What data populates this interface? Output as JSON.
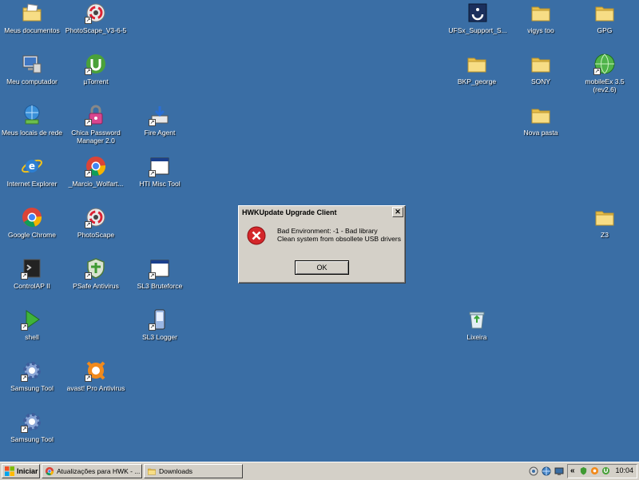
{
  "desktop": {
    "icons": [
      {
        "label": "Meus documentos",
        "icon": "folder-docs-icon"
      },
      {
        "label": "PhotoScape_V3-6-5",
        "icon": "photoscape-icon"
      },
      {
        "label": "Meu computador",
        "icon": "computer-icon"
      },
      {
        "label": "µTorrent",
        "icon": "utorrent-icon"
      },
      {
        "label": "Meus locais de rede",
        "icon": "network-icon"
      },
      {
        "label": "Chica Password\nManager 2.0",
        "icon": "lock-icon"
      },
      {
        "label": "Fire Agent",
        "icon": "download-icon"
      },
      {
        "label": "Internet Explorer",
        "icon": "ie-icon"
      },
      {
        "label": "_Marcio_Wolfart...",
        "icon": "chrome-icon"
      },
      {
        "label": "HTI Misc Tool",
        "icon": "app-window-icon"
      },
      {
        "label": "Google Chrome",
        "icon": "chrome-icon"
      },
      {
        "label": "PhotoScape",
        "icon": "photoscape-icon"
      },
      {
        "label": "ControlAP II",
        "icon": "terminal-icon"
      },
      {
        "label": "PSafe Antivirus",
        "icon": "shield-icon"
      },
      {
        "label": "SL3 Bruteforce",
        "icon": "app-window-icon"
      },
      {
        "label": "shell",
        "icon": "play-icon"
      },
      {
        "label": "SL3 Logger",
        "icon": "phone-icon"
      },
      {
        "label": "Samsung Tool",
        "icon": "gear-icon"
      },
      {
        "label": "avast! Pro Antivirus",
        "icon": "avast-icon"
      },
      {
        "label": "Samsung Tool",
        "icon": "gear-icon"
      },
      {
        "label": "UFSx_Support_S...",
        "icon": "ufs-icon"
      },
      {
        "label": "vigys too",
        "icon": "folder-icon"
      },
      {
        "label": "GPG",
        "icon": "folder-icon"
      },
      {
        "label": "BKP_george",
        "icon": "folder-icon"
      },
      {
        "label": "SONY",
        "icon": "folder-icon"
      },
      {
        "label": "mobileEx 3.5\n(rev2.6)",
        "icon": "globe-icon"
      },
      {
        "label": "Nova pasta",
        "icon": "folder-icon"
      },
      {
        "label": "Z3",
        "icon": "folder-icon"
      },
      {
        "label": "Lixeira",
        "icon": "recycle-bin-icon"
      }
    ]
  },
  "dialog": {
    "title": "HWKUpdate Upgrade Client",
    "close": "✕",
    "message_line1": "Bad Environment: -1 - Bad library",
    "message_line2": "Clean system from obsollete USB drivers",
    "ok_label": "OK",
    "icon": "error-icon"
  },
  "taskbar": {
    "start_label": "Iniciar",
    "task1_label": "Atualizações para HWK - ...",
    "task2_label": "Downloads",
    "tray_chevron": "«",
    "clock": "10:04"
  },
  "colors": {
    "desktop": "#3a6ea5",
    "chrome": "#d4d0c8",
    "error_red": "#d4262a",
    "folder": "#f3d16a"
  }
}
